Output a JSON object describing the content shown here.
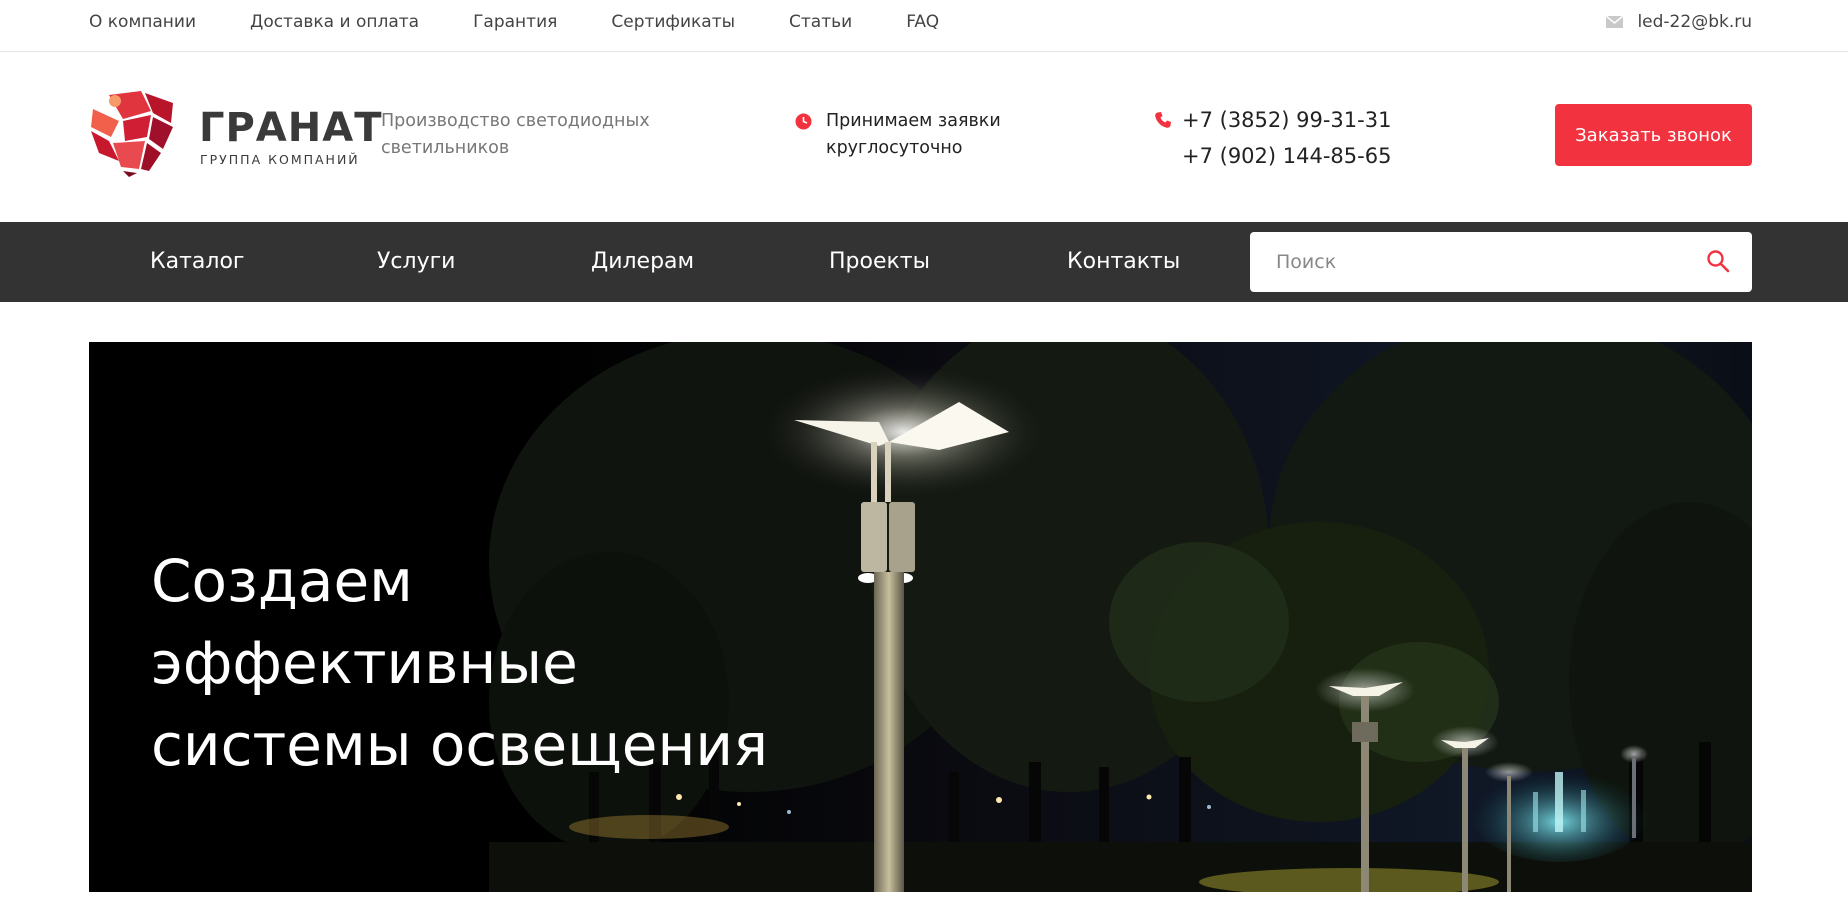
{
  "topbar": {
    "links": [
      "О компании",
      "Доставка и оплата",
      "Гарантия",
      "Сертификаты",
      "Статьи",
      "FAQ"
    ],
    "email": "led-22@bk.ru",
    "email_icon": "mail-icon"
  },
  "header": {
    "logo_name": "ГРАНАТ",
    "logo_sub": "ГРУППА КОМПАНИЙ",
    "tagline": "Производство светодиодных светильников",
    "hours": "Принимаем заявки круглосуточно",
    "phones": [
      "+7 (3852) 99-31-31",
      "+7 (902) 144-85-65"
    ],
    "callback_label": "Заказать звонок"
  },
  "nav": {
    "items": [
      "Каталог",
      "Услуги",
      "Дилерам",
      "Проекты",
      "Контакты"
    ],
    "search_placeholder": "Поиск"
  },
  "hero": {
    "title_line1": "Создаем эффективные",
    "title_line2": "системы освещения"
  },
  "colors": {
    "accent": "#f2333f",
    "nav_bg": "#333333",
    "text": "#222222",
    "muted": "#777777"
  }
}
